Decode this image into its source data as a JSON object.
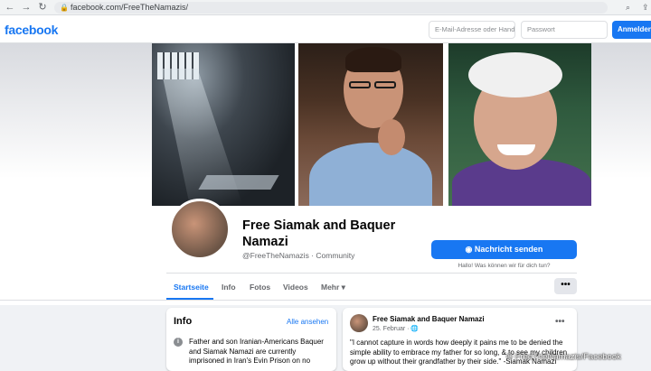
{
  "browser": {
    "url": "facebook.com/FreeTheNamazis/",
    "back_glyph": "←",
    "forward_glyph": "→",
    "reload_glyph": "↻",
    "lock_glyph": "🔒",
    "search_glyph": "⌕",
    "share_glyph": "⇪"
  },
  "topbar": {
    "logo": "facebook",
    "email_placeholder": "E-Mail-Adresse oder Handynummer",
    "password_placeholder": "Passwort",
    "login_label": "Anmelden"
  },
  "colors": {
    "brand": "#1877f2",
    "muted_text": "#65676b"
  },
  "profile": {
    "name": "Free Siamak and Baquer Namazi",
    "handle": "@FreeTheNamazis · Community",
    "message_button": "Nachricht senden",
    "message_icon": "messenger-icon",
    "message_hint": "Hallo! Was können wir für dich tun?"
  },
  "tabs": [
    {
      "label": "Startseite",
      "active": true
    },
    {
      "label": "Info"
    },
    {
      "label": "Fotos"
    },
    {
      "label": "Videos"
    },
    {
      "label": "Mehr ▾"
    }
  ],
  "more_button": "•••",
  "info": {
    "heading": "Info",
    "see_all": "Alle ansehen",
    "icon": "i",
    "text": "Father and son Iranian-Americans Baquer and Siamak Namazi are currently imprisoned in Iran's Evin Prison on no"
  },
  "post": {
    "author": "Free Siamak and Baquer Namazi",
    "date": "25. Februar · 🌐",
    "menu": "•••",
    "text": "\"I cannot capture in words how deeply it pains me to be denied the simple ability to embrace my father for so long, & to see my children grow up without their grandfather by their side.\" -Siamak Namazi"
  },
  "credit": "© FreeTheNamazis/Facebook"
}
